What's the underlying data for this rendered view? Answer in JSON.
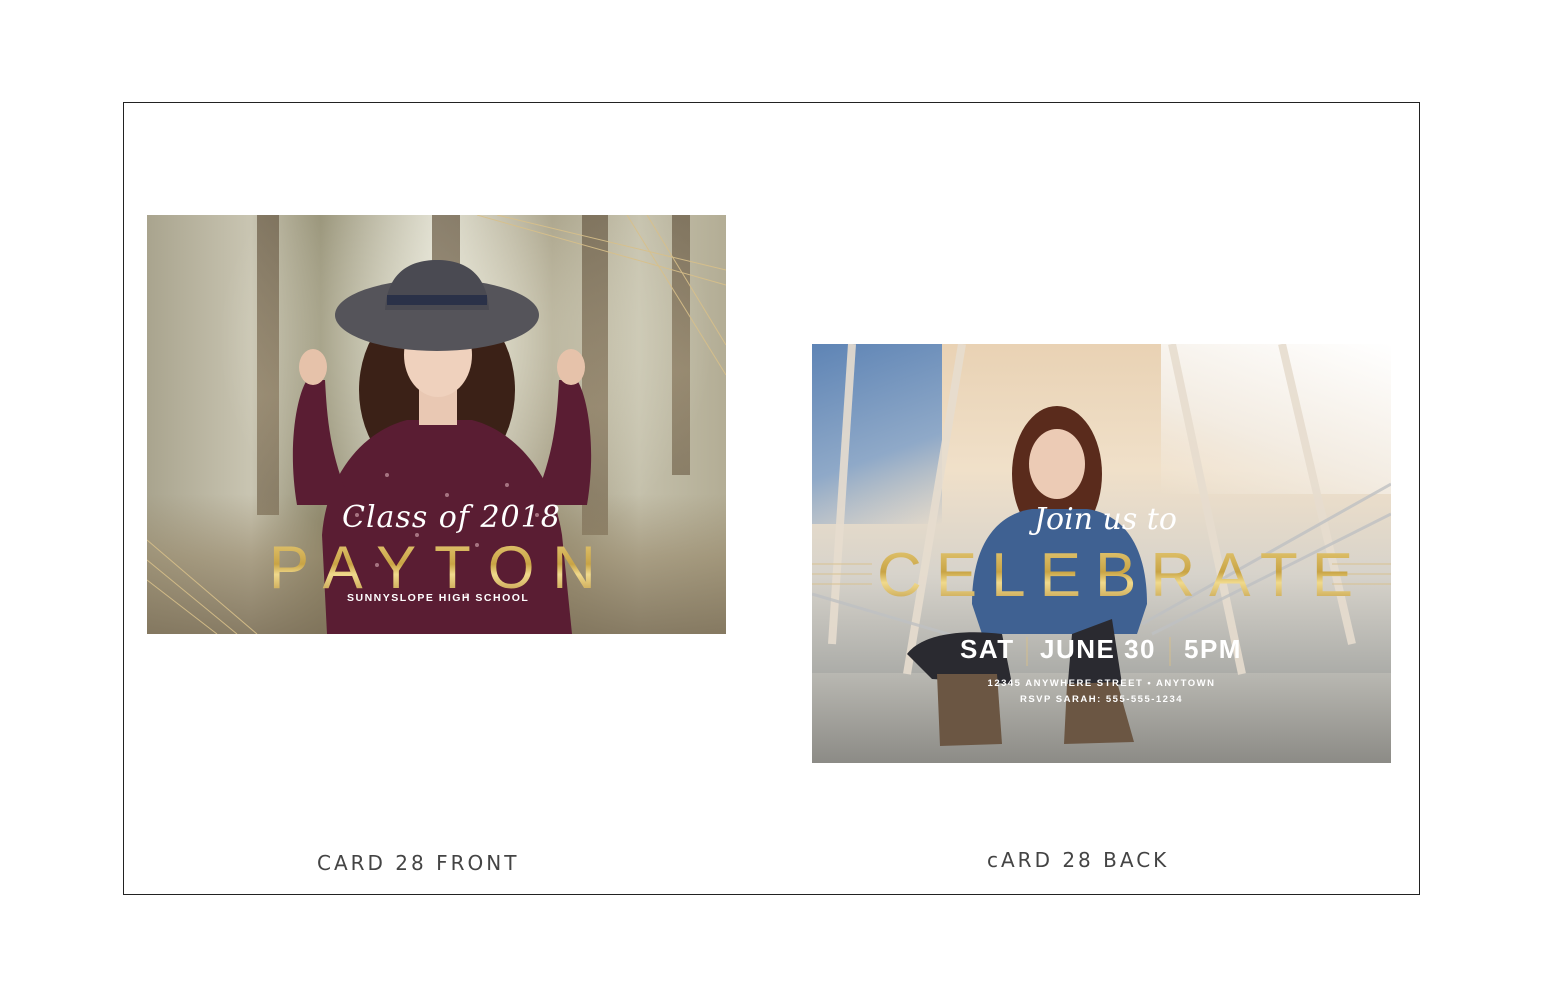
{
  "front_card": {
    "script_line": "Class of 2018",
    "name": "PAYTON",
    "school": "SUNNYSLOPE HIGH SCHOOL",
    "caption": "CARD 28 FRONT"
  },
  "back_card": {
    "script_line": "Join us to",
    "headline": "CELEBRATE",
    "day": "SAT",
    "date": "JUNE 30",
    "time": "5PM",
    "address": "12345 ANYWHERE STREET • ANYTOWN",
    "rsvp": "RSVP SARAH: 555-555-1234",
    "caption": "cARD 28 BACK"
  },
  "colors": {
    "gold": "#c9a445",
    "frame": "#222222",
    "caption": "#444444"
  }
}
